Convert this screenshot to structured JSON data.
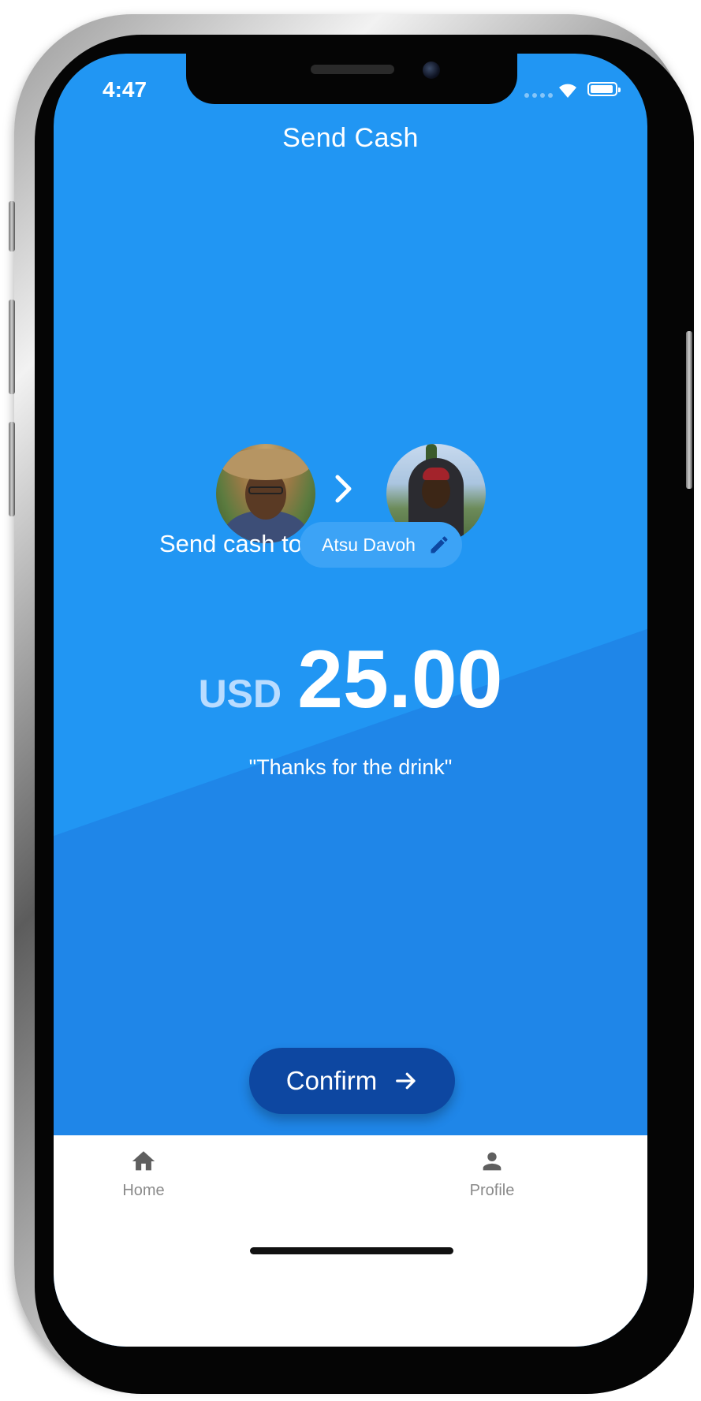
{
  "status_bar": {
    "time": "4:47",
    "battery_level": 0.95
  },
  "header": {
    "title": "Send Cash"
  },
  "transfer": {
    "send_label": "Send cash to",
    "recipient_name": "Atsu Davoh",
    "currency": "USD",
    "amount": "25.00",
    "note": "\"Thanks for the drink\""
  },
  "actions": {
    "confirm_label": "Confirm"
  },
  "tab_bar": {
    "items": [
      {
        "label": "Home",
        "icon": "home-icon"
      },
      {
        "label": "Profile",
        "icon": "person-icon"
      }
    ]
  },
  "colors": {
    "background": "#2196f3",
    "background_diagonal": "#1f86e8",
    "confirm_button": "#0d47a1",
    "chip": "#3ca3f6",
    "currency": "#b9dcff",
    "tab_label": "#8a8a8a"
  }
}
